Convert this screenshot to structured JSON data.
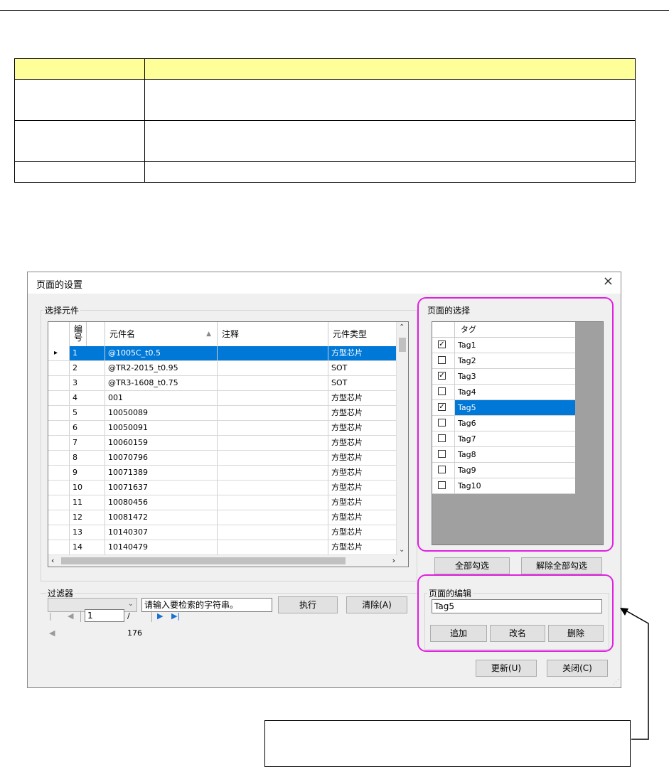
{
  "spec_table": {
    "rows": [
      [
        "",
        ""
      ],
      [
        "",
        ""
      ],
      [
        "",
        ""
      ],
      [
        "",
        ""
      ]
    ]
  },
  "dialog": {
    "title": "页面的设置",
    "close_glyph": "×",
    "parts_group": "选择元件",
    "grid": {
      "columns": [
        "编号",
        "元件名",
        "注释",
        "元件类型"
      ],
      "rows": [
        {
          "no": "1",
          "name": "@1005C_t0.5",
          "note": "",
          "type": "方型芯片"
        },
        {
          "no": "2",
          "name": "@TR2-2015_t0.95",
          "note": "",
          "type": "SOT"
        },
        {
          "no": "3",
          "name": "@TR3-1608_t0.75",
          "note": "",
          "type": "SOT"
        },
        {
          "no": "4",
          "name": "001",
          "note": "",
          "type": "方型芯片"
        },
        {
          "no": "5",
          "name": "10050089",
          "note": "",
          "type": "方型芯片"
        },
        {
          "no": "6",
          "name": "10050091",
          "note": "",
          "type": "方型芯片"
        },
        {
          "no": "7",
          "name": "10060159",
          "note": "",
          "type": "方型芯片"
        },
        {
          "no": "8",
          "name": "10070796",
          "note": "",
          "type": "方型芯片"
        },
        {
          "no": "9",
          "name": "10071389",
          "note": "",
          "type": "方型芯片"
        },
        {
          "no": "10",
          "name": "10071637",
          "note": "",
          "type": "方型芯片"
        },
        {
          "no": "11",
          "name": "10080456",
          "note": "",
          "type": "方型芯片"
        },
        {
          "no": "12",
          "name": "10081472",
          "note": "",
          "type": "方型芯片"
        },
        {
          "no": "13",
          "name": "10140307",
          "note": "",
          "type": "方型芯片"
        },
        {
          "no": "14",
          "name": "10140479",
          "note": "",
          "type": "方型芯片"
        }
      ]
    },
    "filter": {
      "label": "过滤器",
      "combo_value": "",
      "search_value": "请输入要检索的字符串。",
      "execute": "执行",
      "clear": "清除(A)"
    },
    "pager": {
      "current": "1",
      "total": "/ 176"
    },
    "page_select": {
      "label": "页面的选择",
      "header": "タグ",
      "tags": [
        {
          "name": "Tag1",
          "checked": true
        },
        {
          "name": "Tag2",
          "checked": false
        },
        {
          "name": "Tag3",
          "checked": true
        },
        {
          "name": "Tag4",
          "checked": false
        },
        {
          "name": "Tag5",
          "checked": true
        },
        {
          "name": "Tag6",
          "checked": false
        },
        {
          "name": "Tag7",
          "checked": false
        },
        {
          "name": "Tag8",
          "checked": false
        },
        {
          "name": "Tag9",
          "checked": false
        },
        {
          "name": "Tag10",
          "checked": false
        }
      ],
      "selected": "Tag5",
      "check_all": "全部勾选",
      "uncheck_all": "解除全部勾选"
    },
    "page_edit": {
      "label": "页面的编辑",
      "value": "Tag5",
      "add": "追加",
      "rename": "改名",
      "delete": "删除"
    },
    "update": "更新(U)",
    "close": "关闭(C)"
  },
  "colors": {
    "highlight": "#e020e0",
    "selection": "#0078d7",
    "table_header": "#ffff99"
  }
}
